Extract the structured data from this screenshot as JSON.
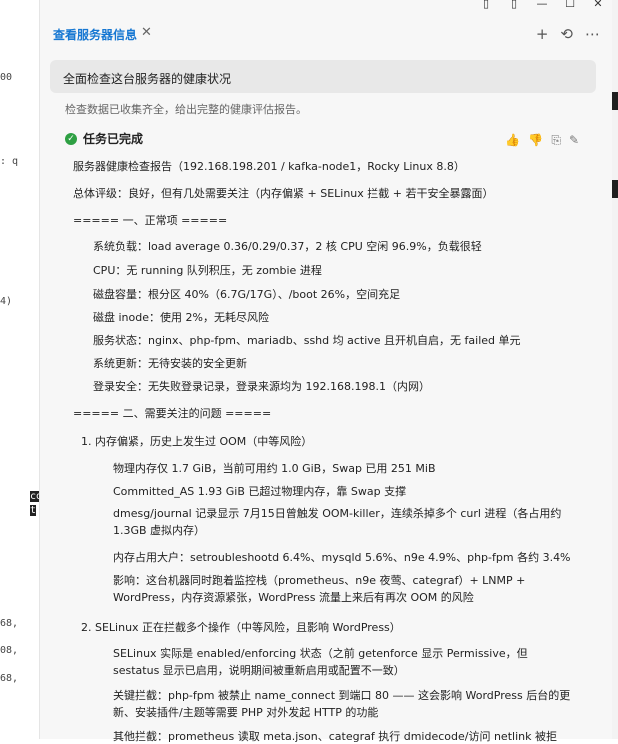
{
  "gutter": {
    "fragments": [
      "00",
      ": q",
      "4)",
      "co",
      "t",
      "68,",
      "08,",
      "68,"
    ]
  },
  "window": {
    "controls": [
      "▯",
      "▯",
      "—",
      "☐",
      "✕"
    ]
  },
  "tab": {
    "title": "查看服务器信息",
    "close": "✕",
    "actions": [
      "+",
      "⟲",
      "⋯"
    ]
  },
  "prompt": "全面检查这台服务器的健康状况",
  "summary": "检查数据已收集齐全，给出完整的健康评估报告。",
  "task": {
    "status": "任务已完成",
    "check_icon": "✓",
    "feedback": [
      "👍",
      "👎",
      "⎘",
      "✎"
    ]
  },
  "report": {
    "header": "服务器健康检查报告（192.168.198.201 / kafka-node1，Rocky Linux 8.8）",
    "overall": "总体评级：良好，但有几处需要关注（内存偏紧 + SELinux 拦截 + 若干安全暴露面）",
    "section1_title": "===== 一、正常项 =====",
    "section1_items": [
      "系统负载：load average 0.36/0.29/0.37，2 核 CPU 空闲 96.9%，负载很轻",
      "CPU：无 running 队列积压，无 zombie 进程",
      "磁盘容量：根分区 40%（6.7G/17G）、/boot 26%，空间充足",
      "磁盘 inode：使用 2%，无耗尽风险",
      "服务状态：nginx、php-fpm、mariadb、sshd 均 active 且开机自启，无 failed 单元",
      "系统更新：无待安装的安全更新",
      "登录安全：无失败登录记录，登录来源均为 192.168.198.1（内网）"
    ],
    "section2_title": "===== 二、需要关注的问题 =====",
    "issue1_title": "1. 内存偏紧，历史上发生过 OOM（中等风险）",
    "issue1_items": [
      "物理内存仅 1.7 GiB，当前可用约 1.0 GiB，Swap 已用 251 MiB",
      "Committed_AS 1.93 GiB 已超过物理内存，靠 Swap 支撑",
      "dmesg/journal 记录显示 7月15日曾触发 OOM-killer，连续杀掉多个 curl 进程（各占用约 1.3GB 虚拟内存）",
      "内存占用大户：setroubleshootd 6.4%、mysqld 5.6%、n9e 4.9%、php-fpm 各约 3.4%",
      "影响：这台机器同时跑着监控栈（prometheus、n9e 夜莺、categraf）+ LNMP + WordPress，内存资源紧张，WordPress 流量上来后有再次 OOM 的风险"
    ],
    "issue2_title": "2. SELinux 正在拦截多个操作（中等风险，且影响 WordPress）",
    "issue2_items": [
      "SELinux 实际是 enabled/enforcing 状态（之前 getenforce 显示 Permissive，但 sestatus 显示已启用，说明期间被重新启用或配置不一致）",
      "关键拦截：php-fpm 被禁止 name_connect 到端口 80 —— 这会影响 WordPress 后台的更新、安装插件/主题等需要 PHP 对外发起 HTTP 的功能",
      "其他拦截：prometheus 读取 meta.json、categraf 执行 dmidecode/访问 netlink 被拒"
    ]
  }
}
